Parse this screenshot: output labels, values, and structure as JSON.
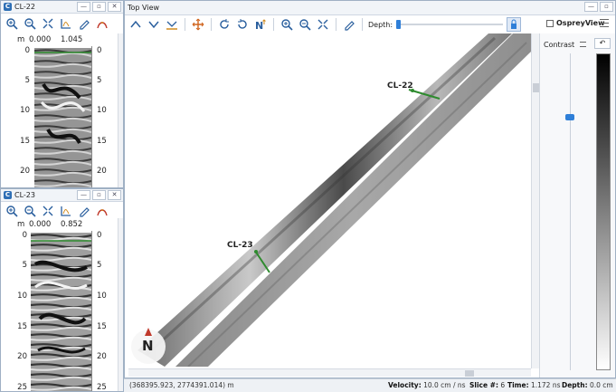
{
  "window_cl22": {
    "title": "CL-22",
    "scale_label": "m",
    "scale_start": "0.000",
    "scale_end": "1.045",
    "depth_ticks": [
      "0",
      "5",
      "10",
      "15",
      "20"
    ]
  },
  "window_cl23": {
    "title": "CL-23",
    "scale_label": "m",
    "scale_start": "0.000",
    "scale_end": "0.852",
    "depth_ticks": [
      "0",
      "5",
      "10",
      "15",
      "20",
      "25"
    ]
  },
  "topview": {
    "title": "Top View",
    "depth_label": "Depth:",
    "ospreyview_label": "OspreyView",
    "contrast_label": "Contrast",
    "line_labels": {
      "cl22": "CL-22",
      "cl23": "CL-23"
    },
    "compass_letter": "N"
  },
  "status": {
    "coords": "(368395.923, 2774391.014) m",
    "velocity_label": "Velocity:",
    "velocity_value": "10.0 cm / ns",
    "slice_label": "Slice #:",
    "slice_value": "6",
    "time_label": "Time:",
    "time_value": "1.172 ns",
    "depth_label": "Depth:",
    "depth_value": "0.0 cm"
  },
  "colors": {
    "accent": "#2f7fd8",
    "marker_line": "#2e8b2e",
    "title_bg": "#f1f4f8"
  }
}
